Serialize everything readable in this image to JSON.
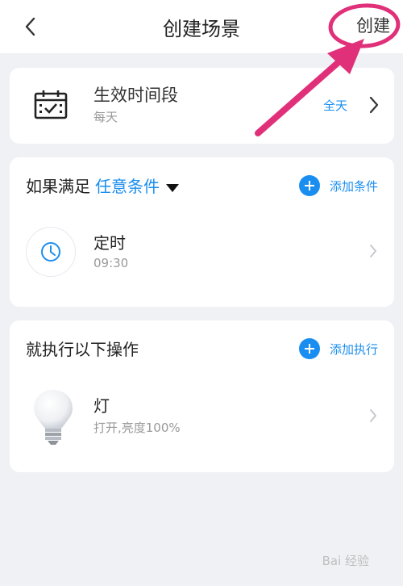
{
  "header": {
    "title": "创建场景",
    "create_label": "创建"
  },
  "schedule": {
    "title": "生效时间段",
    "subtitle": "每天",
    "value": "全天"
  },
  "conditions": {
    "prefix": "如果满足",
    "mode": "任意条件",
    "add_label": "添加条件",
    "items": [
      {
        "title": "定时",
        "subtitle": "09:30"
      }
    ]
  },
  "actions": {
    "title": "就执行以下操作",
    "add_label": "添加执行",
    "items": [
      {
        "title": "灯",
        "subtitle": "打开,亮度100%"
      }
    ]
  },
  "watermark": "Bai 经验",
  "colors": {
    "accent": "#1a8ef0",
    "annotation": "#e0307a",
    "background": "#f0f1f5"
  }
}
